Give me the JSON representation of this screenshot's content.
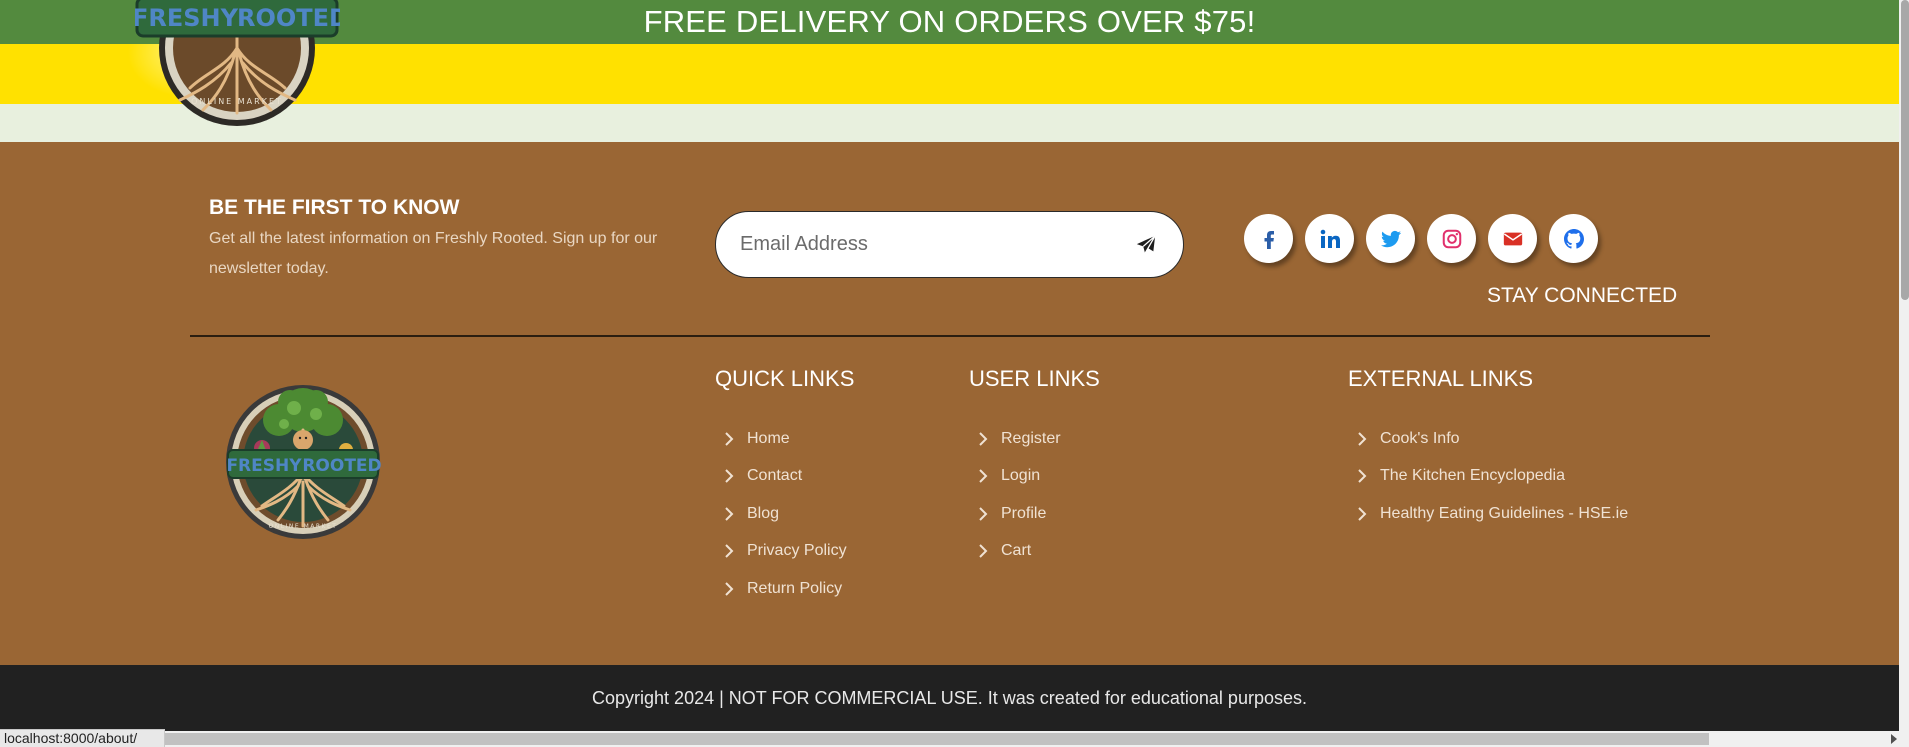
{
  "banner": {
    "delivery_message": "FREE DELIVERY ON ORDERS OVER $75!"
  },
  "logo": {
    "brand_word_1": "FRESHY",
    "brand_word_2": "ROOTED",
    "tagline": "ONLINE MARKET"
  },
  "newsletter": {
    "heading": "BE THE FIRST TO KNOW",
    "text": "Get all the latest information on Freshly Rooted. Sign up for our newsletter today.",
    "email_placeholder": "Email Address",
    "send_icon": "paper-plane-icon"
  },
  "social": {
    "items": [
      {
        "name": "facebook-icon",
        "color": "#1877f2"
      },
      {
        "name": "linkedin-icon",
        "color": "#0a66c2"
      },
      {
        "name": "twitter-icon",
        "color": "#1d9bf0"
      },
      {
        "name": "instagram-icon",
        "color": "#e1306c"
      },
      {
        "name": "envelope-icon",
        "color": "#d93025"
      },
      {
        "name": "github-icon",
        "color": "#1f6feb"
      }
    ],
    "label": "STAY CONNECTED"
  },
  "quick_links": {
    "heading": "QUICK LINKS",
    "items": [
      "Home",
      "Contact",
      "Blog",
      "Privacy Policy",
      "Return Policy"
    ]
  },
  "user_links": {
    "heading": "USER LINKS",
    "items": [
      "Register",
      "Login",
      "Profile",
      "Cart"
    ]
  },
  "external_links": {
    "heading": "EXTERNAL LINKS",
    "items": [
      "Cook's Info",
      "The Kitchen Encyclopedia",
      "Healthy Eating Guidelines - HSE.ie"
    ]
  },
  "copyright": {
    "text": "Copyright 2024 | NOT FOR COMMERCIAL USE. It was created for educational purposes."
  },
  "status_bar": {
    "url": "localhost:8000/about/"
  },
  "colors": {
    "delivery_bar": "#538a3e",
    "hero_yellow": "#ffe100",
    "footer_brown": "#9a6634",
    "copyright_bg": "#212121"
  }
}
